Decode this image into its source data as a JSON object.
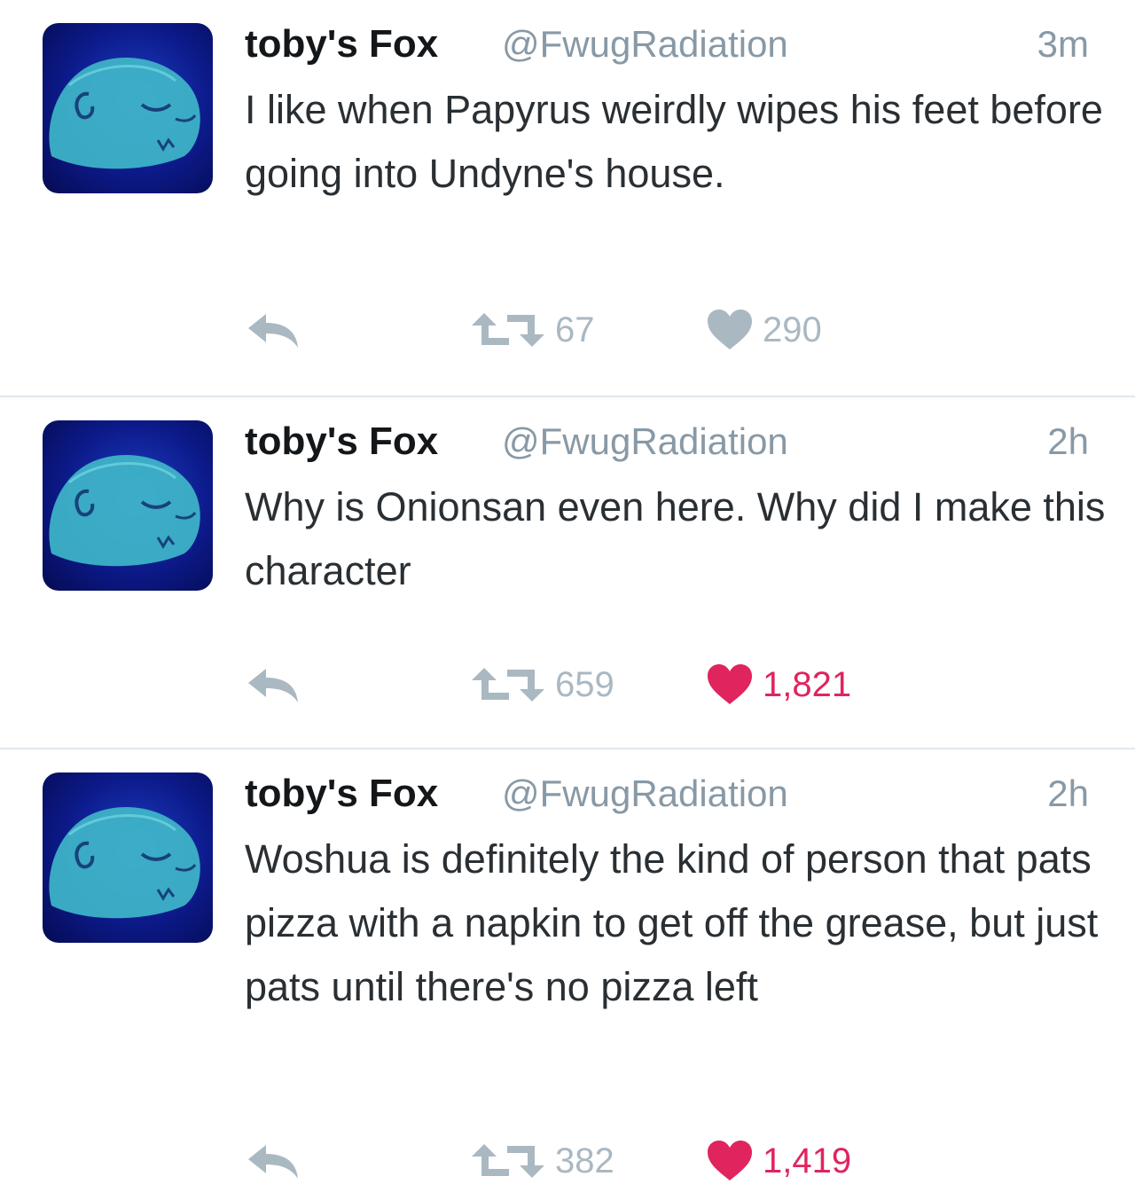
{
  "tweets": [
    {
      "display_name": "toby's Fox",
      "handle": "@FwugRadiation",
      "time": "3m",
      "text": "I like when Papyrus weirdly wipes his feet before going into Undyne's house.",
      "retweets": "67",
      "likes": "290",
      "liked": false
    },
    {
      "display_name": "toby's Fox",
      "handle": "@FwugRadiation",
      "time": "2h",
      "text": "Why is Onionsan even here. Why did I make this character",
      "retweets": "659",
      "likes": "1,821",
      "liked": true
    },
    {
      "display_name": "toby's Fox",
      "handle": "@FwugRadiation",
      "time": "2h",
      "text": "Woshua is definitely the kind of person that pats pizza with a napkin to get off the grease, but just pats until there's no pizza left",
      "retweets": "382",
      "likes": "1,419",
      "liked": true
    }
  ],
  "icons": {
    "reply": "reply-arrow-icon",
    "retweet": "retweet-icon",
    "like": "heart-icon",
    "avatar": "dog-avatar-image"
  },
  "colors": {
    "muted": "#aab8c2",
    "liked": "#e0245e",
    "text": "#292f33",
    "handle": "#8899a6"
  }
}
